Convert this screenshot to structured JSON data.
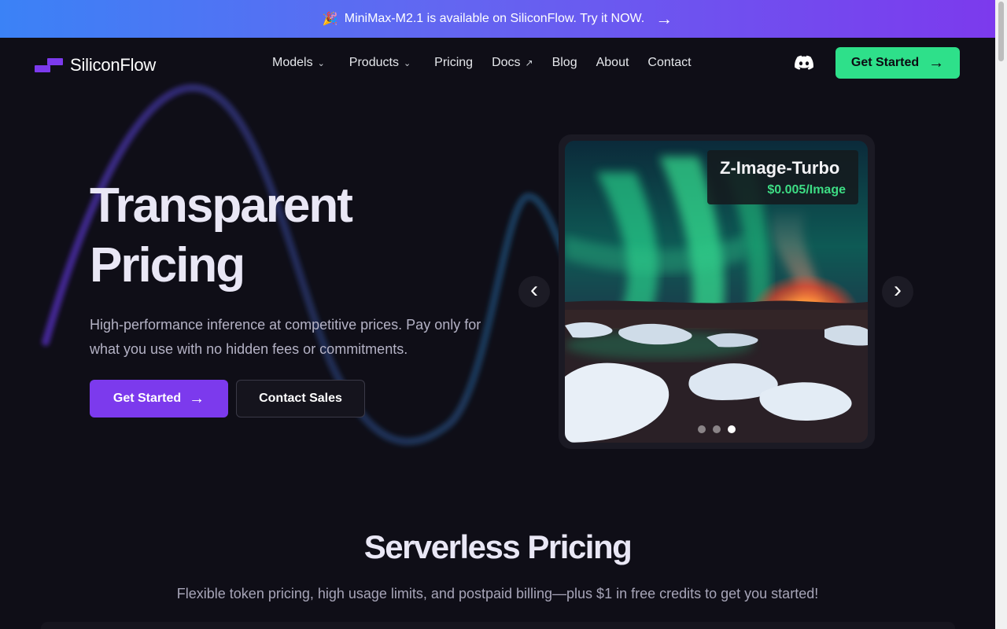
{
  "banner": {
    "icon": "party-popper-icon",
    "text": "MiniMax-M2.1 is available on SiliconFlow. Try it NOW.",
    "arrow": "→"
  },
  "nav": {
    "logo_text": "SiliconFlow",
    "items": [
      {
        "label": "Models",
        "dropdown": true
      },
      {
        "label": "Products",
        "dropdown": true
      },
      {
        "label": "Pricing",
        "dropdown": false
      },
      {
        "label": "Docs",
        "external": true
      },
      {
        "label": "Blog",
        "dropdown": false
      },
      {
        "label": "About",
        "dropdown": false
      },
      {
        "label": "Contact",
        "dropdown": false
      }
    ],
    "cta_label": "Get Started",
    "cta_arrow": "→"
  },
  "hero": {
    "title_line1": "Transparent",
    "title_line2": "Pricing",
    "subtitle": "High-performance inference at competitive prices. Pay only for what you use with no hidden fees or commitments.",
    "primary_label": "Get Started",
    "primary_arrow": "→",
    "secondary_label": "Contact Sales"
  },
  "carousel": {
    "model_name": "Z-Image-Turbo",
    "price": "$0.005/Image",
    "slide_count": 3,
    "active_index": 2,
    "prev_icon": "‹",
    "next_icon": "›"
  },
  "serverless": {
    "title": "Serverless Pricing",
    "subtitle": "Flexible token pricing, high usage limits, and postpaid billing—plus $1 in free credits to get you started!"
  },
  "colors": {
    "background": "#0f0e17",
    "accent_purple": "#7c3aed",
    "accent_green": "#2ee08a",
    "price_green": "#3ddc84"
  }
}
